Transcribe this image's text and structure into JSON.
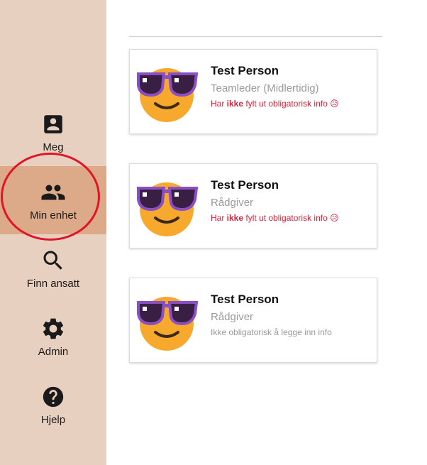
{
  "nav": [
    {
      "label": "Meg",
      "icon": "account-box-icon"
    },
    {
      "label": "Min enhet",
      "icon": "group-icon",
      "active": true
    },
    {
      "label": "Finn ansatt",
      "icon": "search-icon"
    },
    {
      "label": "Admin",
      "icon": "gear-icon"
    },
    {
      "label": "Hjelp",
      "icon": "help-circle-icon"
    }
  ],
  "colors": {
    "sidebar": "#e8d0c0",
    "active": "#dcaa88",
    "highlight_circle": "#e0152a",
    "warning_text": "#d4243c"
  },
  "people": [
    {
      "name": "Test Person",
      "role": "Teamleder (Midlertidig)",
      "status_pre": "Har ",
      "status_bold": "ikke",
      "status_post": " fylt ut obligatorisk info ",
      "status_emoji": "😥",
      "status_type": "warn"
    },
    {
      "name": "Test Person",
      "role": "Rådgiver",
      "status_pre": "Har ",
      "status_bold": "ikke",
      "status_post": " fylt ut obligatorisk info ",
      "status_emoji": "😥",
      "status_type": "warn"
    },
    {
      "name": "Test Person",
      "role": "Rådgiver",
      "status_pre": "Ikke obligatorisk å legge inn info",
      "status_bold": "",
      "status_post": "",
      "status_emoji": "",
      "status_type": "ok"
    }
  ]
}
